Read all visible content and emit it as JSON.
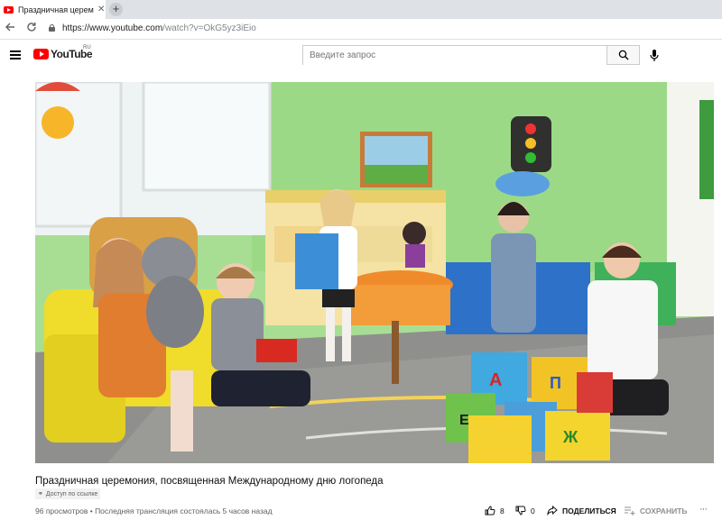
{
  "browser": {
    "tab_title": "Праздничная церемони",
    "tab_close": "✕",
    "new_tab": "+",
    "url_host": "https://www.youtube.com",
    "url_path": "/watch?v=OkG5yz3iEio"
  },
  "header": {
    "logo_text": "YouTube",
    "region": "RU",
    "search_placeholder": "Введите запрос"
  },
  "video": {
    "title": "Праздничная церемония, посвященная Международному дню логопеда",
    "privacy_badge": "Доступ по ссылке",
    "meta": "96 просмотров • Последняя трансляция состоялась 5 часов назад",
    "likes": "8",
    "dislikes": "0",
    "share_label": "ПОДЕЛИТЬСЯ",
    "save_label": "СОХРАНИТЬ",
    "more_label": "···"
  },
  "colors": {
    "brand_red": "#ff0000",
    "wall_green": "#9ed98c"
  },
  "icons": {
    "back": "back-arrow-icon",
    "reload": "reload-icon",
    "lock": "lock-icon",
    "menu": "hamburger-menu-icon",
    "search": "search-icon",
    "mic": "microphone-icon",
    "like": "thumbs-up-icon",
    "dislike": "thumbs-down-icon",
    "share": "share-arrow-icon",
    "save": "add-to-playlist-icon",
    "link": "link-icon"
  }
}
